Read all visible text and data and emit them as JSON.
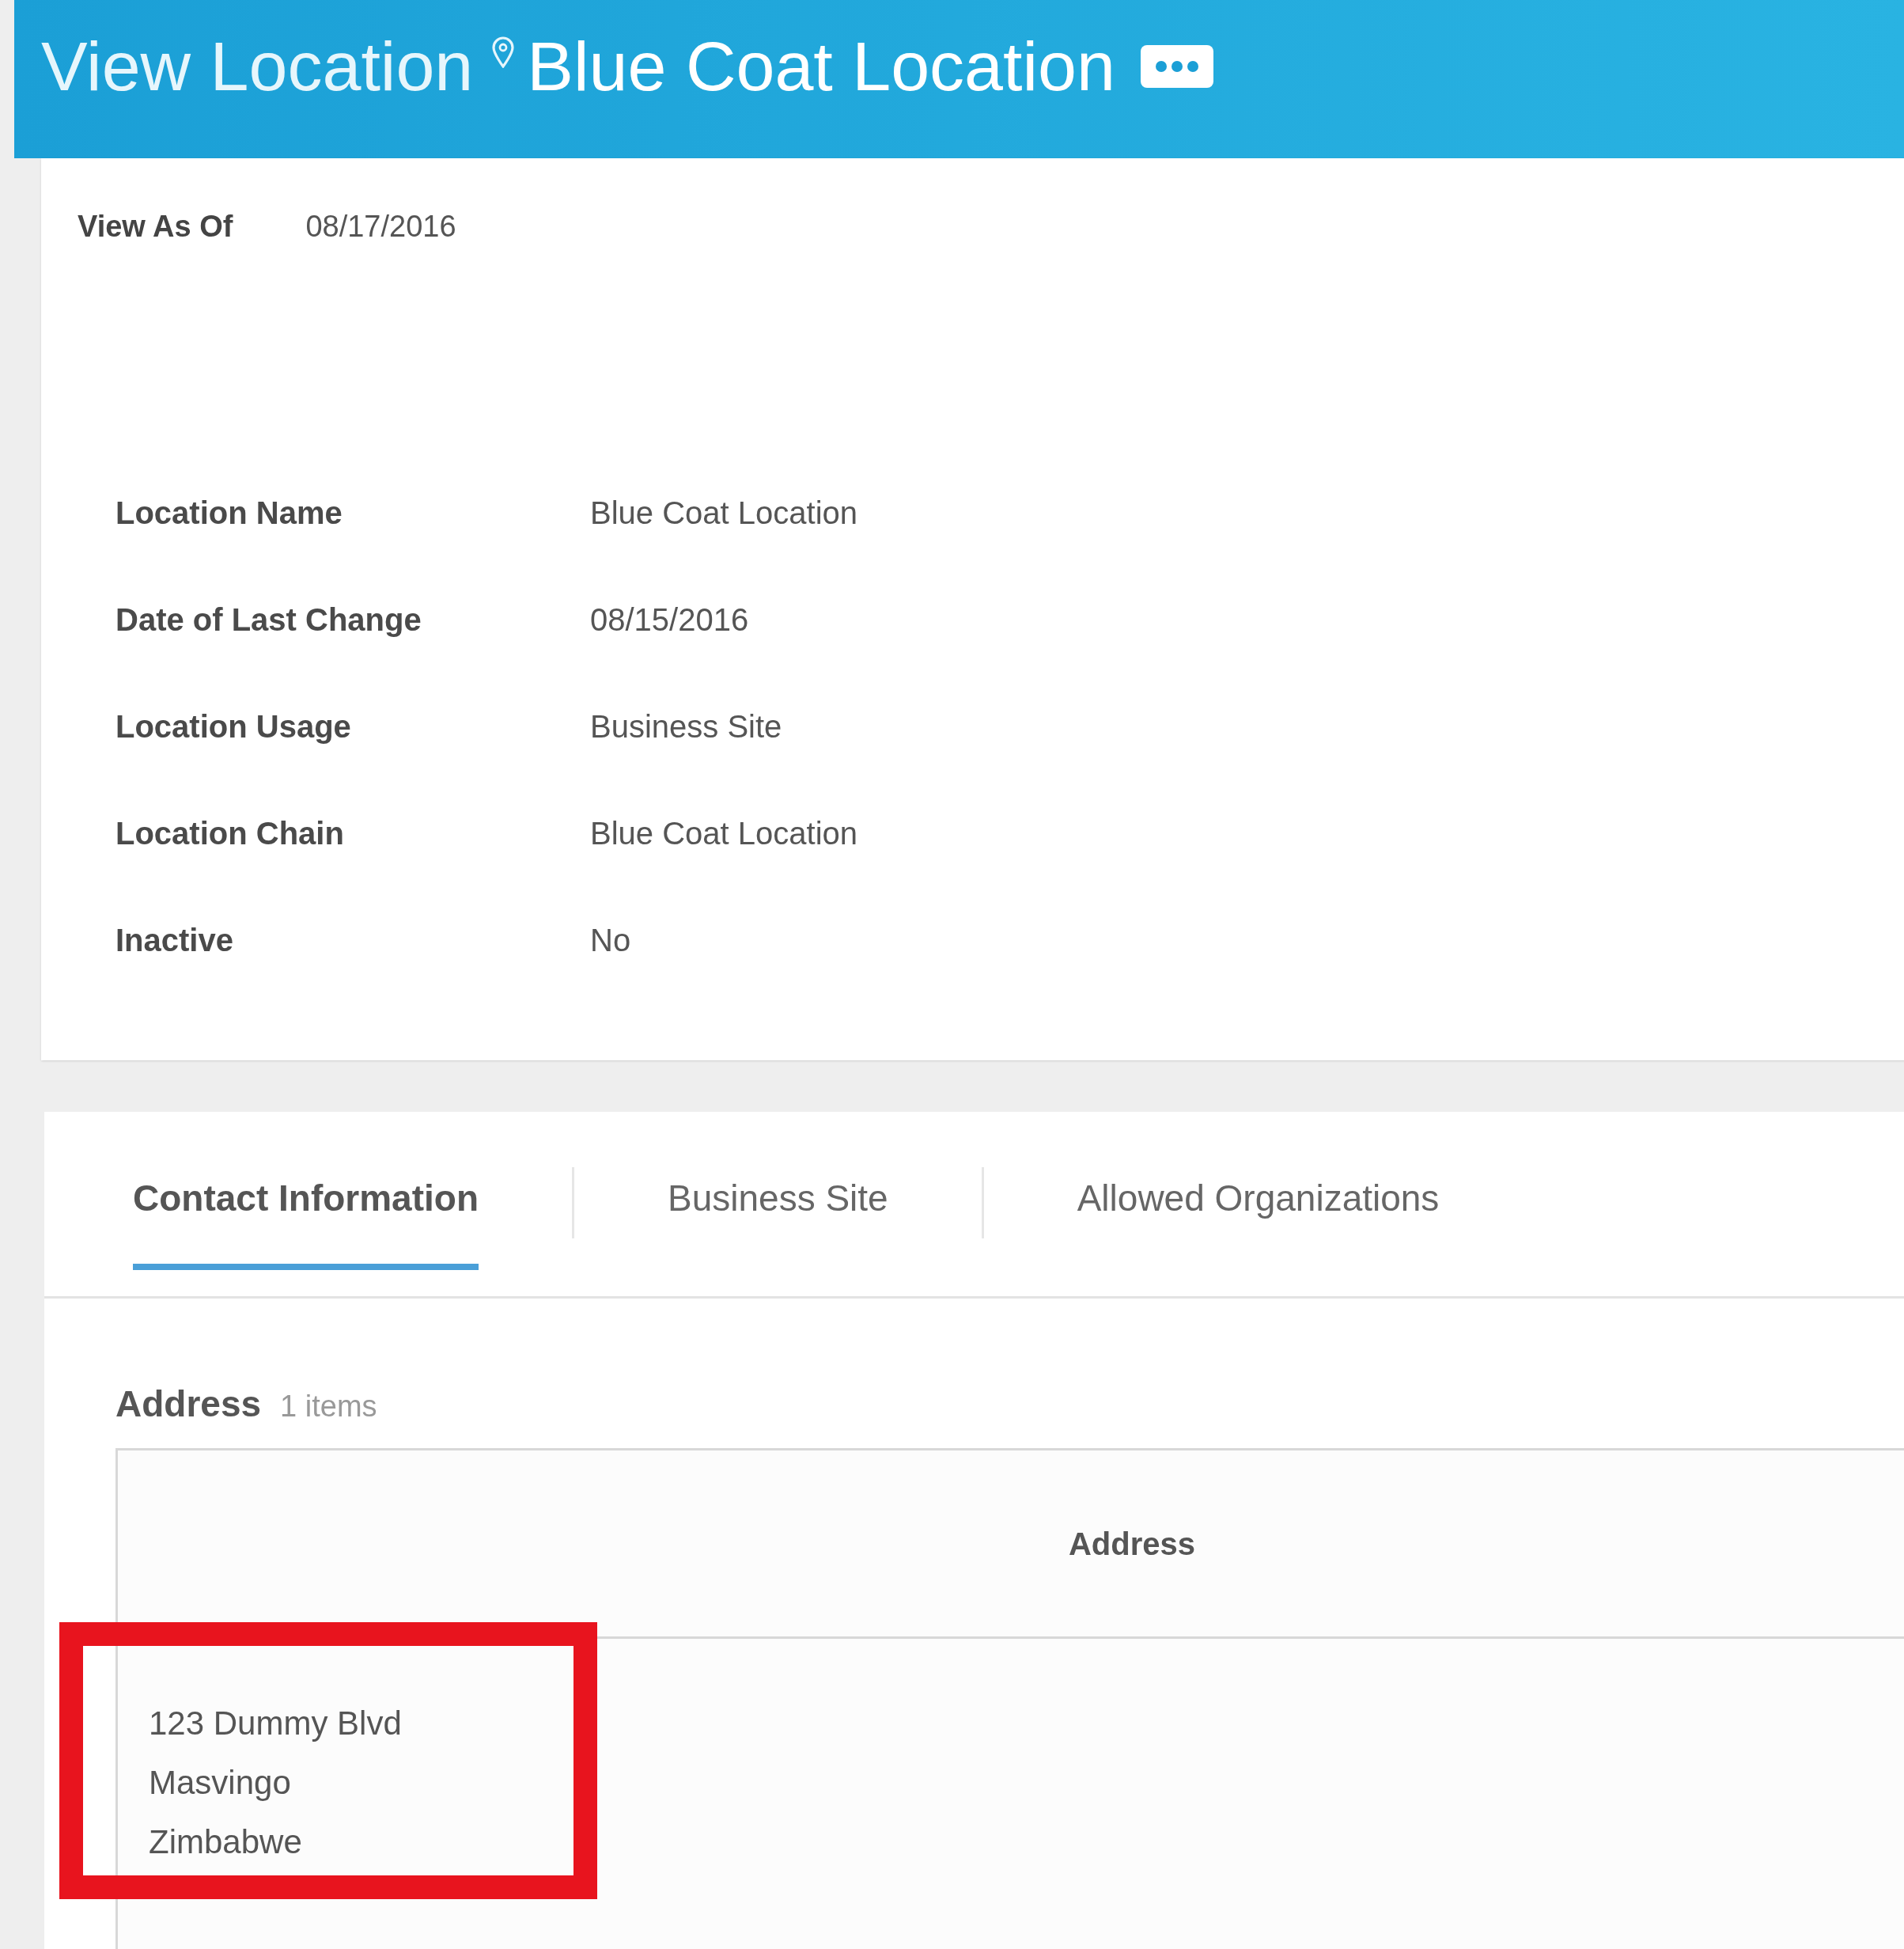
{
  "header": {
    "prefix": "View Location",
    "title": "Blue Coat Location"
  },
  "view_as_of": {
    "label": "View As Of",
    "value": "08/17/2016"
  },
  "fields": [
    {
      "label": "Location Name",
      "value": "Blue Coat Location"
    },
    {
      "label": "Date of Last Change",
      "value": "08/15/2016"
    },
    {
      "label": "Location Usage",
      "value": "Business Site"
    },
    {
      "label": "Location Chain",
      "value": "Blue Coat Location"
    },
    {
      "label": "Inactive",
      "value": "No"
    }
  ],
  "tabs": [
    {
      "label": "Contact Information",
      "selected": true
    },
    {
      "label": "Business Site",
      "selected": false
    },
    {
      "label": "Allowed Organizations",
      "selected": false
    }
  ],
  "address_section": {
    "title": "Address",
    "count": "1 items",
    "table": {
      "columns": [
        "Address"
      ],
      "rows": [
        {
          "lines": [
            "123 Dummy Blvd",
            "Masvingo",
            "Zimbabwe"
          ],
          "highlighted": true
        }
      ]
    }
  }
}
